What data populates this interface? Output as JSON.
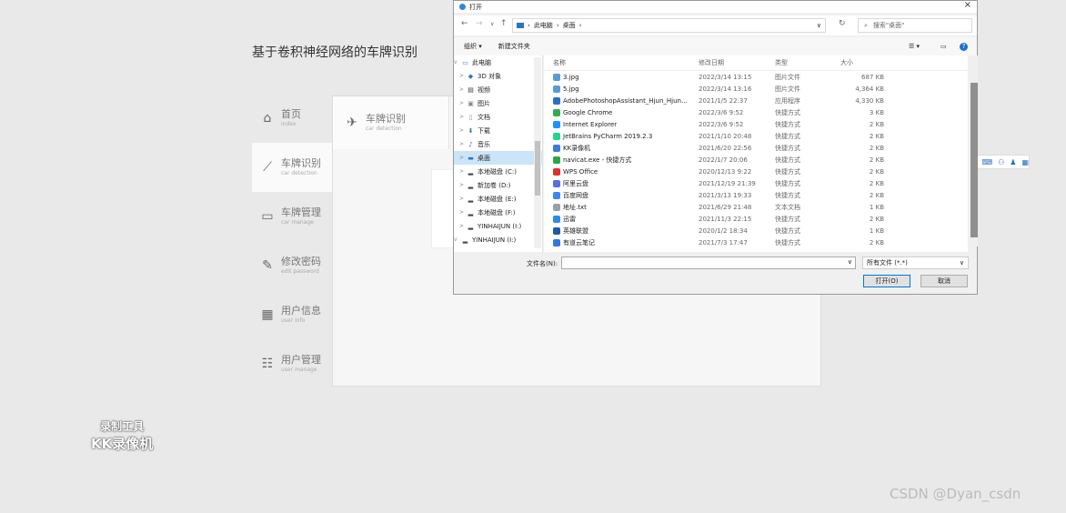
{
  "app": {
    "title": "基于卷积神经网络的车牌识别",
    "nav": [
      {
        "label": "首页",
        "sub": "index",
        "icon": "home-icon"
      },
      {
        "label": "车牌识别",
        "sub": "car detection",
        "icon": "chart-icon"
      },
      {
        "label": "车牌管理",
        "sub": "car manage",
        "icon": "card-icon"
      },
      {
        "label": "修改密码",
        "sub": "edit password",
        "icon": "edit-icon"
      },
      {
        "label": "用户信息",
        "sub": "user info",
        "icon": "user-info-icon"
      },
      {
        "label": "用户管理",
        "sub": "user manage",
        "icon": "users-icon"
      }
    ],
    "panel_tab": {
      "label": "车牌识别",
      "sub": "car detection"
    }
  },
  "dialog": {
    "title": "打开",
    "breadcrumb": [
      "此电脑",
      "桌面"
    ],
    "search_placeholder": "搜索\"桌面\"",
    "toolbar": {
      "organize": "组织 ▾",
      "new_folder": "新建文件夹"
    },
    "tree": [
      {
        "label": "此电脑",
        "icon": "computer-icon",
        "expand": "v"
      },
      {
        "label": "3D 对象",
        "icon": "cube-icon",
        "expand": ">"
      },
      {
        "label": "视频",
        "icon": "video-icon",
        "expand": ">"
      },
      {
        "label": "图片",
        "icon": "picture-icon",
        "expand": ">"
      },
      {
        "label": "文档",
        "icon": "document-icon",
        "expand": ">"
      },
      {
        "label": "下载",
        "icon": "download-icon",
        "expand": ">"
      },
      {
        "label": "音乐",
        "icon": "music-icon",
        "expand": ">"
      },
      {
        "label": "桌面",
        "icon": "desktop-icon",
        "expand": ">",
        "selected": true
      },
      {
        "label": "本地磁盘 (C:)",
        "icon": "drive-icon",
        "expand": ">"
      },
      {
        "label": "新加卷 (D:)",
        "icon": "drive-icon",
        "expand": ">"
      },
      {
        "label": "本地磁盘 (E:)",
        "icon": "drive-icon",
        "expand": ">"
      },
      {
        "label": "本地磁盘 (F:)",
        "icon": "drive-icon",
        "expand": ">"
      },
      {
        "label": "YINHAIJUN (I:)",
        "icon": "usb-icon",
        "expand": ">"
      },
      {
        "label": "YINHAIJUN (I:)",
        "icon": "usb-icon",
        "expand": "v"
      }
    ],
    "columns": {
      "name": "名称",
      "date": "修改日期",
      "type": "类型",
      "size": "大小"
    },
    "files": [
      {
        "name": "3.jpg",
        "date": "2022/3/14 13:15",
        "type": "图片文件",
        "size": "687 KB",
        "color": "#5b9bd5"
      },
      {
        "name": "5.jpg",
        "date": "2022/3/14 13:16",
        "type": "图片文件",
        "size": "4,364 KB",
        "color": "#5b9bd5"
      },
      {
        "name": "AdobePhotoshopAssistant_Hjun_Hjun...",
        "date": "2021/1/5 22:37",
        "type": "应用程序",
        "size": "4,330 KB",
        "color": "#2a6fc9"
      },
      {
        "name": "Google Chrome",
        "date": "2022/3/6 9:52",
        "type": "快捷方式",
        "size": "3 KB",
        "color": "#34a853"
      },
      {
        "name": "Internet Explorer",
        "date": "2022/3/6 9:52",
        "type": "快捷方式",
        "size": "2 KB",
        "color": "#1e90ff"
      },
      {
        "name": "JetBrains PyCharm 2019.2.3",
        "date": "2021/1/10 20:48",
        "type": "快捷方式",
        "size": "2 KB",
        "color": "#21d789"
      },
      {
        "name": "KK录像机",
        "date": "2021/6/20 22:56",
        "type": "快捷方式",
        "size": "2 KB",
        "color": "#3b7ddd"
      },
      {
        "name": "navicat.exe - 快捷方式",
        "date": "2022/1/7 20:06",
        "type": "快捷方式",
        "size": "2 KB",
        "color": "#27a844"
      },
      {
        "name": "WPS Office",
        "date": "2020/12/13 9:22",
        "type": "快捷方式",
        "size": "2 KB",
        "color": "#d9342b"
      },
      {
        "name": "阿里云盘",
        "date": "2021/12/19 21:39",
        "type": "快捷方式",
        "size": "2 KB",
        "color": "#5b6ee1"
      },
      {
        "name": "百度网盘",
        "date": "2021/3/13 19:33",
        "type": "快捷方式",
        "size": "2 KB",
        "color": "#3d85f5"
      },
      {
        "name": "地址.txt",
        "date": "2021/6/29 21:48",
        "type": "文本文档",
        "size": "1 KB",
        "color": "#9aa0a6"
      },
      {
        "name": "迅雷",
        "date": "2021/11/3 22:15",
        "type": "快捷方式",
        "size": "2 KB",
        "color": "#2c8ae8"
      },
      {
        "name": "英雄联盟",
        "date": "2020/1/2 18:34",
        "type": "快捷方式",
        "size": "1 KB",
        "color": "#1c5aa6"
      },
      {
        "name": "有道云笔记",
        "date": "2021/7/3 17:47",
        "type": "快捷方式",
        "size": "2 KB",
        "color": "#3376e0"
      }
    ],
    "filename_label": "文件名(N):",
    "filetype": "所有文件 (*.*)",
    "open_btn": "打开(O)",
    "cancel_btn": "取消"
  },
  "watermark": {
    "line1": "录制工具",
    "line2": "KK录像机"
  },
  "credit": "CSDN @Dyan_csdn",
  "ime": {
    "logo": "S",
    "mode": "中"
  }
}
